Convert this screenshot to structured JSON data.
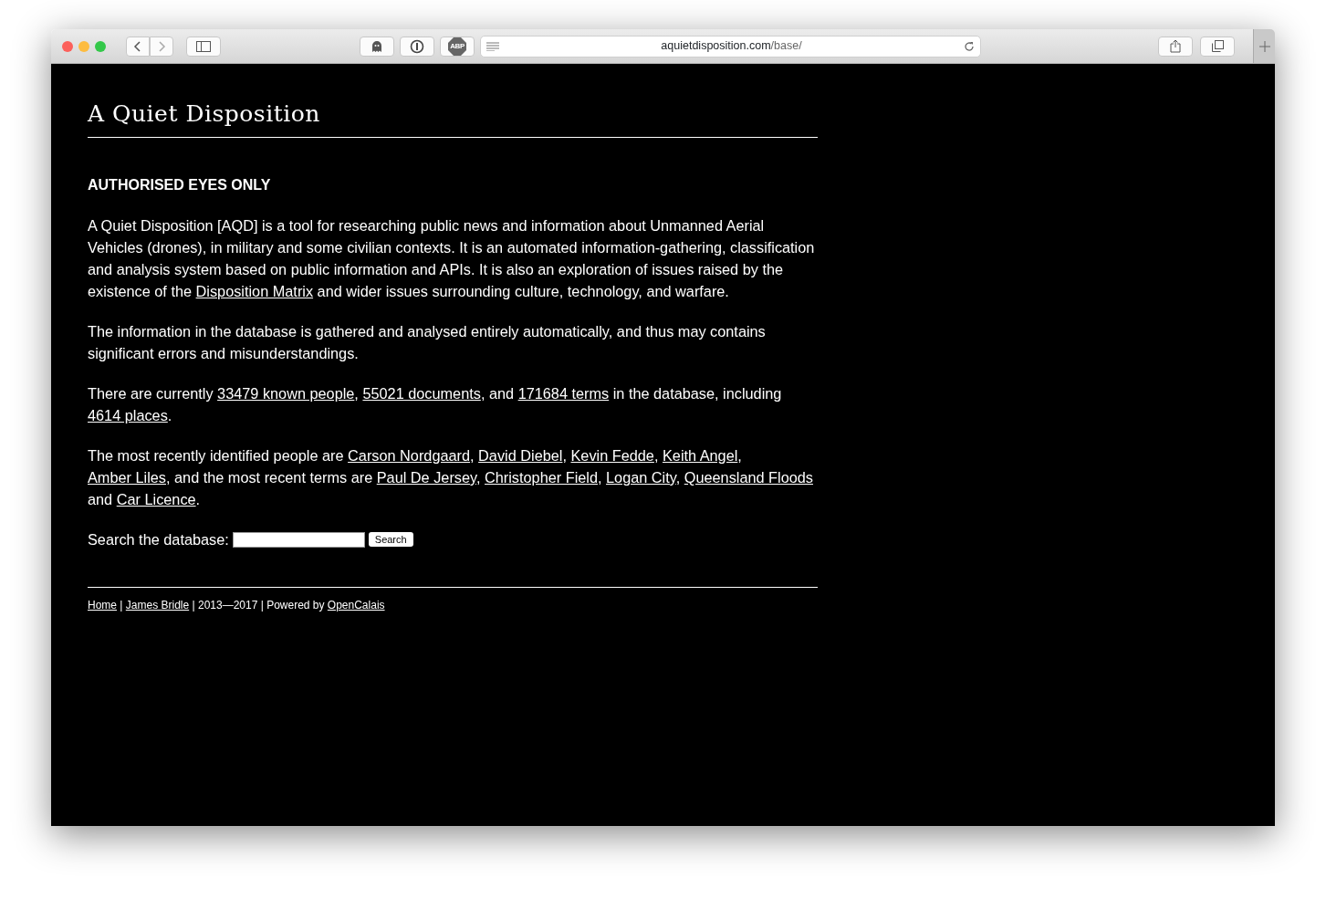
{
  "browser": {
    "adblock_label": "ABP",
    "url_host": "aquietdisposition.com",
    "url_path": "/base/"
  },
  "page": {
    "title": "A Quiet Disposition",
    "heading": "AUTHORISED EYES ONLY",
    "paragraphs": [
      [
        {
          "kind": "text",
          "text": "A Quiet Disposition [AQD] is a tool for researching public news and information about Unmanned Aerial Vehicles (drones), in military and some civilian contexts. It is an automated information-gathering, classification and analysis system based on public information and APIs. It is also an exploration of issues raised by the existence of the "
        },
        {
          "kind": "link",
          "text": "Disposition Matrix"
        },
        {
          "kind": "text",
          "text": " and wider issues surrounding culture, technology, and warfare."
        }
      ],
      [
        {
          "kind": "text",
          "text": "The information in the database is gathered and analysed entirely automatically, and thus may contains significant errors and misunderstandings."
        }
      ],
      [
        {
          "kind": "text",
          "text": "There are currently "
        },
        {
          "kind": "link",
          "text": "33479 known people"
        },
        {
          "kind": "text",
          "text": ", "
        },
        {
          "kind": "link",
          "text": "55021 documents"
        },
        {
          "kind": "text",
          "text": ", and "
        },
        {
          "kind": "link",
          "text": "171684 terms"
        },
        {
          "kind": "text",
          "text": " in the database, including "
        },
        {
          "kind": "link",
          "text": "4614 places"
        },
        {
          "kind": "text",
          "text": "."
        }
      ],
      [
        {
          "kind": "text",
          "text": "The most recently identified people are "
        },
        {
          "kind": "link",
          "text": "Carson Nordgaard"
        },
        {
          "kind": "text",
          "text": ", "
        },
        {
          "kind": "link",
          "text": "David Diebel"
        },
        {
          "kind": "text",
          "text": ", "
        },
        {
          "kind": "link",
          "text": "Kevin Fedde"
        },
        {
          "kind": "text",
          "text": ", "
        },
        {
          "kind": "link",
          "text": "Keith Angel"
        },
        {
          "kind": "text",
          "text": ", "
        },
        {
          "kind": "link",
          "text": "Amber Liles"
        },
        {
          "kind": "text",
          "text": ", and the most recent terms are "
        },
        {
          "kind": "link",
          "text": "Paul De Jersey"
        },
        {
          "kind": "text",
          "text": ", "
        },
        {
          "kind": "link",
          "text": "Christopher Field"
        },
        {
          "kind": "text",
          "text": ", "
        },
        {
          "kind": "link",
          "text": "Logan City"
        },
        {
          "kind": "text",
          "text": ", "
        },
        {
          "kind": "link",
          "text": "Queensland Floods"
        },
        {
          "kind": "text",
          "text": " and "
        },
        {
          "kind": "link",
          "text": "Car Licence"
        },
        {
          "kind": "text",
          "text": "."
        }
      ]
    ],
    "search": {
      "label": "Search the database:",
      "button": "Search"
    },
    "footer": [
      {
        "kind": "link",
        "text": "Home"
      },
      {
        "kind": "text",
        "text": " | "
      },
      {
        "kind": "link",
        "text": "James Bridle"
      },
      {
        "kind": "text",
        "text": " | 2013—2017 | Powered by "
      },
      {
        "kind": "link",
        "text": "OpenCalais"
      }
    ]
  }
}
